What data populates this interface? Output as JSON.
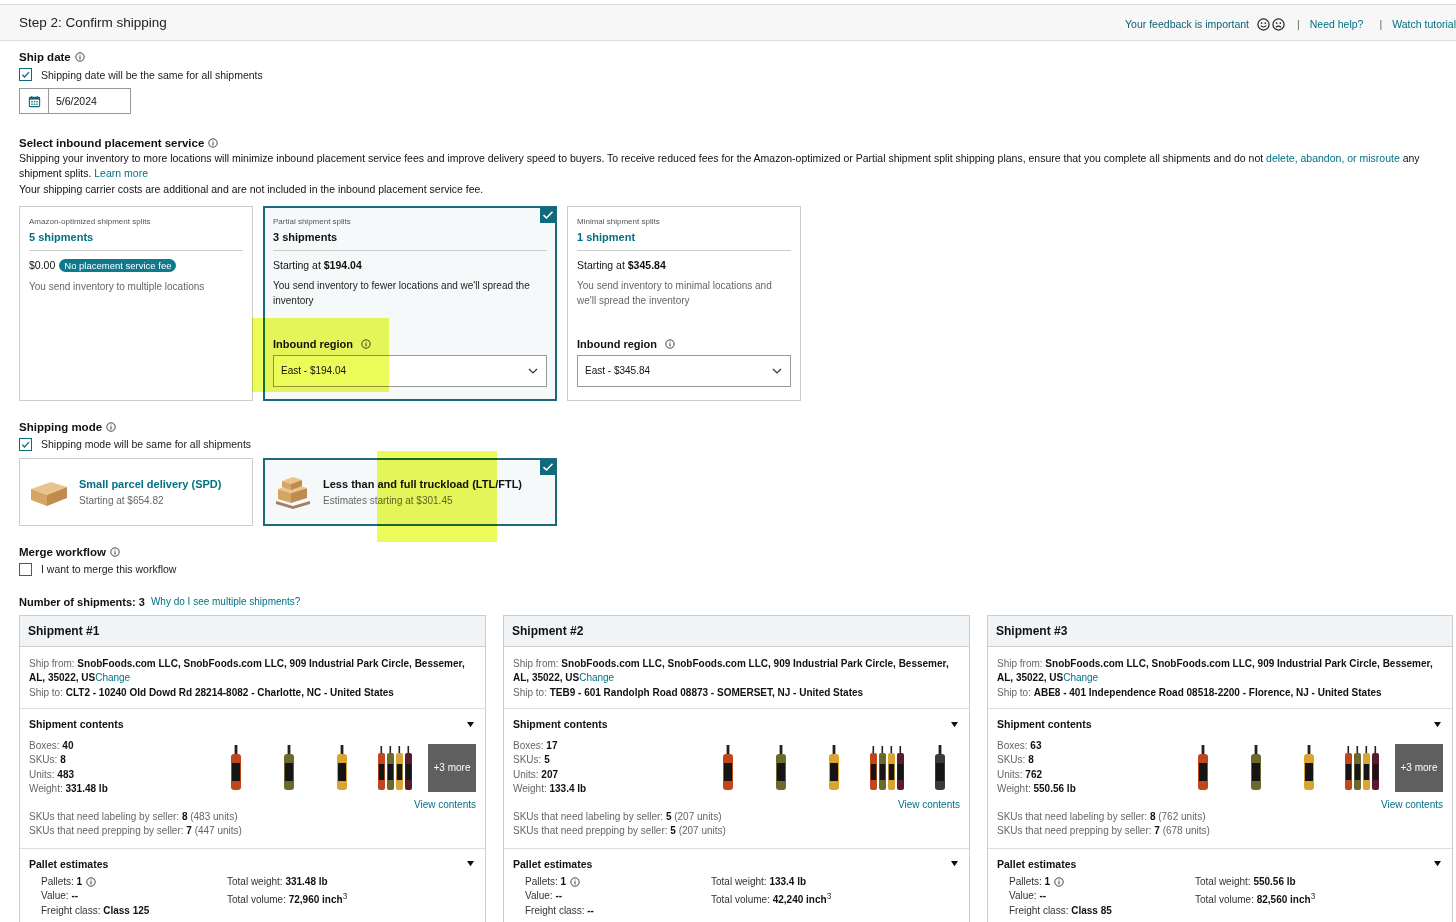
{
  "header": {
    "title": "Step 2: Confirm shipping",
    "feedback": "Your feedback is important",
    "links": [
      {
        "separator": "|",
        "text": "Need help?"
      },
      {
        "separator": "|",
        "text": "Watch tutorial"
      }
    ]
  },
  "ship_date": {
    "title": "Ship date",
    "same_for_all": {
      "label": "Shipping date will be the same for all shipments",
      "checked": true
    },
    "date": "5/6/2024"
  },
  "placement": {
    "title": "Select inbound placement service",
    "paragraph": [
      {
        "text": "Shipping your inventory to more locations will minimize inbound placement service fees and improve delivery speed to buyers. To receive reduced fees for the Amazon-optimized or Partial shipment split shipping plans, ensure that you complete all shipments and do not ",
        "link": false
      },
      {
        "text": "delete, abandon, or misroute",
        "link": true
      },
      {
        "text": " any shipment splits. ",
        "link": false
      },
      {
        "text": "Learn more",
        "link": true
      }
    ],
    "note": "Your shipping carrier costs are additional and are not included in the inbound placement service fee.",
    "options": [
      {
        "label": "Amazon-optimized shipment splits",
        "title": "5 shipments",
        "selected": false,
        "price": "$0.00",
        "badge": "No placement service fee",
        "description": "You send inventory to multiple locations"
      },
      {
        "label": "Partial shipment splits",
        "title": "3 shipments",
        "selected": true,
        "price": "Starting at **$194.04**",
        "description": "You send inventory to fewer locations and we'll spread the inventory",
        "region_label": "Inbound region",
        "region_value": "East - $194.04",
        "highlighted": true
      },
      {
        "label": "Minimal shipment splits",
        "title": "1 shipment",
        "selected": false,
        "price": "Starting at **$345.84**",
        "description": "You send inventory to minimal locations and we'll spread the inventory",
        "region_label": "Inbound region",
        "region_value": "East - $345.84",
        "highlighted": false
      }
    ]
  },
  "shipping_mode": {
    "title": "Shipping mode",
    "same_for_all": {
      "label": "Shipping mode will be same for all shipments",
      "checked": true
    },
    "modes": [
      {
        "kind": "parcel",
        "title": "Small parcel delivery (SPD)",
        "subtitle": "Starting at $654.82",
        "selected": false,
        "highlighted": false
      },
      {
        "kind": "pallet",
        "title": "Less than and full truckload (LTL/FTL)",
        "subtitle": "Estimates starting at $301.45",
        "selected": true,
        "highlighted": true
      }
    ]
  },
  "merge": {
    "title": "Merge workflow",
    "option": {
      "label": "I want to merge this workflow",
      "checked": false
    }
  },
  "shipments_count": {
    "label": "Number of shipments: 3",
    "link": "Why do I see multiple shipments?"
  },
  "shipments": [
    {
      "title": "Shipment #1",
      "ship_from": "Ship from: **SnobFoods.com LLC, SnobFoods.com LLC, 909 Industrial Park Circle, Bessemer, AL, 35022, US**",
      "change": "Change",
      "ship_to": "Ship to: **CLT2 - 10240 Old Dowd Rd 28214-8082 - Charlotte, NC - United States**",
      "contents": {
        "title": "Shipment contents",
        "expanded": true,
        "stats": [
          "Boxes: **40**",
          "SKUs: **8**",
          "Units: **483**",
          "Weight: **331.48 lb**"
        ],
        "thumbnails": [
          {
            "kind": "picture"
          },
          {
            "kind": "picture"
          },
          {
            "kind": "picture"
          },
          {
            "kind": "picture"
          }
        ],
        "more": "+3 more",
        "view": "View contents",
        "needs": [
          "SKUs that need labeling by seller: **8** (483 units)",
          "SKUs that need prepping by seller: **7** (447 units)"
        ]
      },
      "pallets": {
        "title": "Pallet estimates",
        "expanded": true,
        "left": [
          "Pallets: **1**",
          "Value: **--**",
          "Freight class: **Class 125**"
        ],
        "right": [
          "Total weight: **331.48 lb**",
          "Total volume: **72,960 inch**$^{3}$"
        ]
      }
    },
    {
      "title": "Shipment #2",
      "ship_from": "Ship from: **SnobFoods.com LLC, SnobFoods.com LLC, 909 Industrial Park Circle, Bessemer, AL, 35022, US**",
      "change": "Change",
      "ship_to": "Ship to: **TEB9 - 601 Randolph Road 08873 - SOMERSET, NJ - United States**",
      "contents": {
        "title": "Shipment contents",
        "expanded": true,
        "stats": [
          "Boxes: **17**",
          "SKUs: **5**",
          "Units: **207**",
          "Weight: **133.4 lb**"
        ],
        "thumbnails": [
          {
            "kind": "picture"
          },
          {
            "kind": "picture"
          },
          {
            "kind": "picture"
          },
          {
            "kind": "picture"
          },
          {
            "kind": "picture"
          }
        ],
        "view": "View contents",
        "needs": [
          "SKUs that need labeling by seller: **5** (207 units)",
          "SKUs that need prepping by seller: **5** (207 units)"
        ]
      },
      "pallets": {
        "title": "Pallet estimates",
        "expanded": true,
        "left": [
          "Pallets: **1**",
          "Value: **--**",
          "Freight class: **--**"
        ],
        "right": [
          "Total weight: **133.4 lb**",
          "Total volume: **42,240 inch**$^{3}$"
        ]
      }
    },
    {
      "title": "Shipment #3",
      "ship_from": "Ship from: **SnobFoods.com LLC, SnobFoods.com LLC, 909 Industrial Park Circle, Bessemer, AL, 35022, US**",
      "change": "Change",
      "ship_to": "Ship to: **ABE8 - 401 Independence Road 08518-2200 - Florence, NJ - United States**",
      "contents": {
        "title": "Shipment contents",
        "expanded": true,
        "stats": [
          "Boxes: **63**",
          "SKUs: **8**",
          "Units: **762**",
          "Weight: **550.56 lb**"
        ],
        "thumbnails": [
          {
            "kind": "picture"
          },
          {
            "kind": "picture"
          },
          {
            "kind": "picture"
          },
          {
            "kind": "picture"
          }
        ],
        "more": "+3 more",
        "view": "View contents",
        "needs": [
          "SKUs that need labeling by seller: **8** (762 units)",
          "SKUs that need prepping by seller: **7** (678 units)"
        ]
      },
      "pallets": {
        "title": "Pallet estimates",
        "expanded": true,
        "left": [
          "Pallets: **1**",
          "Value: **--**",
          "Freight class: **Class 85**"
        ],
        "right": [
          "Total weight: **550.56 lb**",
          "Total volume: **82,560 inch**$^{3}$"
        ]
      }
    }
  ]
}
